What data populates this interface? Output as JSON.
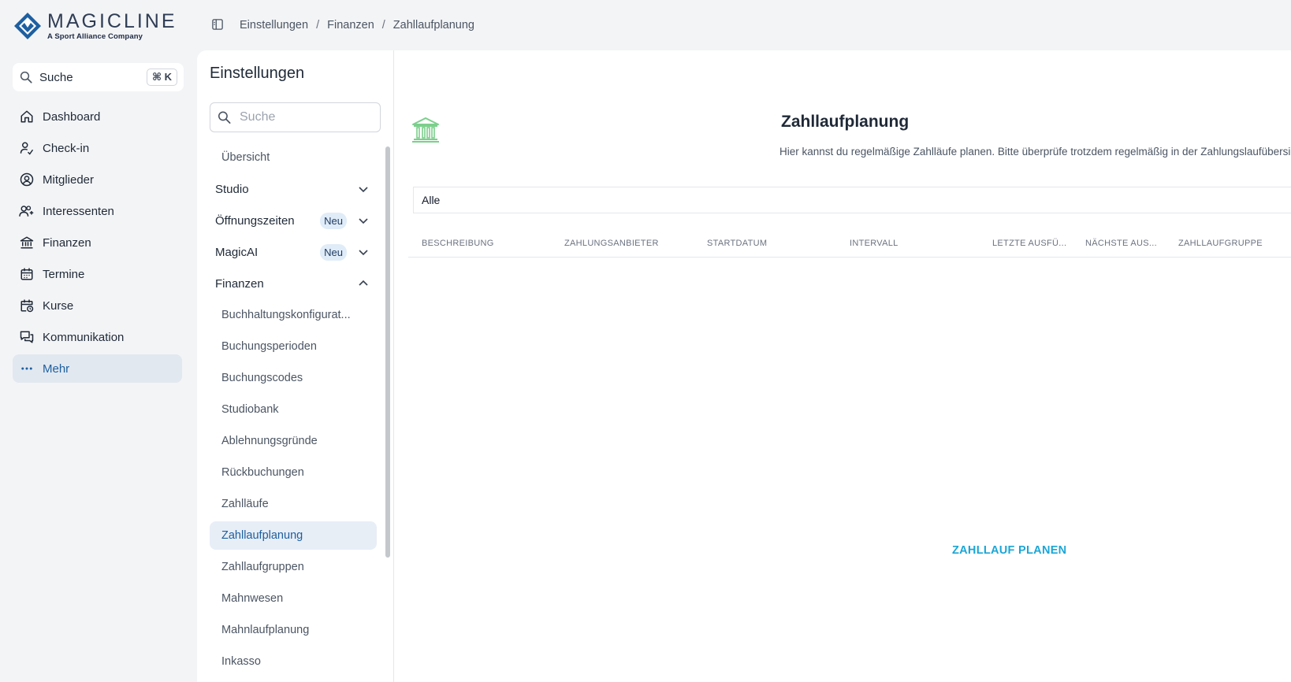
{
  "brand": {
    "name": "MAGICLINE",
    "tagline": "A Sport Alliance Company",
    "color": "#1d5fa0"
  },
  "global_search": {
    "label": "Suche",
    "shortcut": "⌘ K"
  },
  "nav": {
    "items": [
      {
        "label": "Dashboard",
        "icon": "home-icon"
      },
      {
        "label": "Check-in",
        "icon": "user-check-icon"
      },
      {
        "label": "Mitglieder",
        "icon": "user-circle-icon"
      },
      {
        "label": "Interessenten",
        "icon": "user-plus-icon"
      },
      {
        "label": "Finanzen",
        "icon": "bank-icon"
      },
      {
        "label": "Termine",
        "icon": "calendar-icon"
      },
      {
        "label": "Kurse",
        "icon": "calendar-clock-icon"
      },
      {
        "label": "Kommunikation",
        "icon": "chat-icon"
      },
      {
        "label": "Mehr",
        "icon": "more-icon",
        "active": true
      }
    ]
  },
  "breadcrumb": [
    "Einstellungen",
    "Finanzen",
    "Zahllaufplanung"
  ],
  "settings": {
    "title": "Einstellungen",
    "search_placeholder": "Suche",
    "overview": "Übersicht",
    "groups": [
      {
        "label": "Studio",
        "badge": "",
        "expanded": false
      },
      {
        "label": "Öffnungszeiten",
        "badge": "Neu",
        "expanded": false
      },
      {
        "label": "MagicAI",
        "badge": "Neu",
        "expanded": false
      },
      {
        "label": "Finanzen",
        "badge": "",
        "expanded": true
      }
    ],
    "finance_items": [
      "Buchhaltungskonfigurat...",
      "Buchungsperioden",
      "Buchungscodes",
      "Studiobank",
      "Ablehnungsgründe",
      "Rückbuchungen",
      "Zahlläufe",
      "Zahllaufplanung",
      "Zahllaufgruppen",
      "Mahnwesen",
      "Mahnlaufplanung",
      "Inkasso"
    ],
    "active_item": "Zahllaufplanung"
  },
  "main": {
    "title": "Zahllaufplanung",
    "description": "Hier kannst du regelmäßige Zahlläufe planen. Bitte überprüfe trotzdem regelmäßig in der Zahlungslaufübersicht",
    "filter_value": "Alle",
    "columns": [
      "BESCHREIBUNG",
      "ZAHLUNGSANBIETER",
      "STARTDATUM",
      "INTERVALL",
      "LETZTE AUSFÜ...",
      "NÄCHSTE AUS...",
      "ZAHLLAUFGRUPPE"
    ],
    "plan_button": "ZAHLLAUF PLANEN",
    "accent_color": "#1ba6d6",
    "icon_color": "#7ccf8c"
  }
}
